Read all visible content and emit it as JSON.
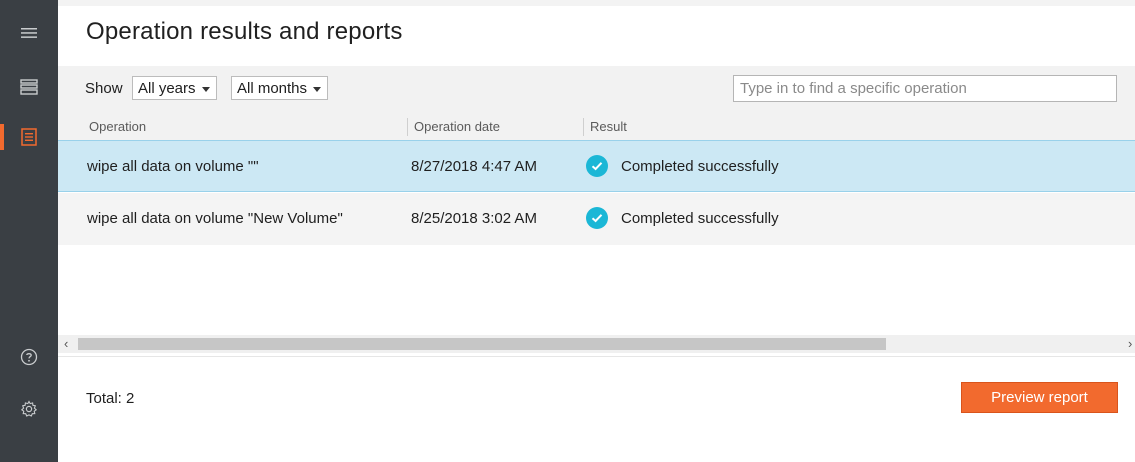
{
  "page": {
    "title": "Operation results and reports"
  },
  "sidebar": {
    "items": [
      {
        "icon": "hamburger-menu-icon"
      },
      {
        "icon": "drive-icon"
      },
      {
        "icon": "report-list-icon",
        "active": true
      },
      {
        "icon": "help-icon"
      },
      {
        "icon": "gear-icon"
      }
    ]
  },
  "filters": {
    "show_label": "Show",
    "year_selected": "All years",
    "month_selected": "All months",
    "search_placeholder": "Type in to find a specific operation"
  },
  "table": {
    "columns": [
      "Operation",
      "Operation date",
      "Result"
    ],
    "rows": [
      {
        "operation": "wipe all data on volume \"\"",
        "date": "8/27/2018 4:47 AM",
        "result": "Completed successfully",
        "selected": true
      },
      {
        "operation": "wipe all data on volume \"New Volume\"",
        "date": "8/25/2018 3:02 AM",
        "result": "Completed successfully",
        "selected": false
      }
    ]
  },
  "footer": {
    "total": "Total: 2",
    "preview_label": "Preview report"
  },
  "colors": {
    "accent": "#f26a2e",
    "success": "#1bb7d6",
    "selection": "#cce8f4",
    "sidebar": "#3a3f44"
  }
}
